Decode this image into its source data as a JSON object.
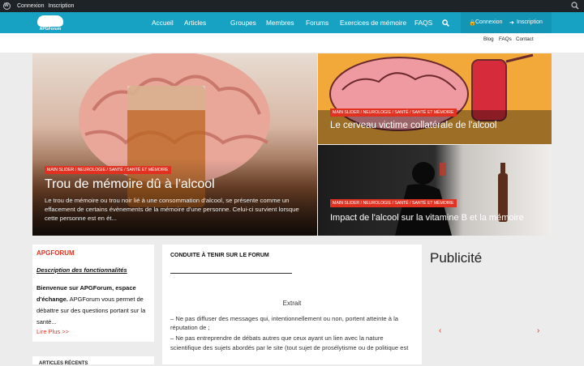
{
  "adminbar": {
    "connexion": "Connexion",
    "inscription": "Inscription"
  },
  "brand": {
    "logo_text": "APGForum"
  },
  "nav": {
    "items": [
      "Accueil",
      "Articles",
      "Groupes",
      "Membres",
      "Forums",
      "Exercices de mémoire",
      "FAQS"
    ],
    "connexion": "Connexion",
    "inscription": "Inscription"
  },
  "subnav": {
    "items": [
      "Blog",
      "FAQs",
      "Contact"
    ]
  },
  "slides": [
    {
      "tag": "Main Slider / Neurologie / Santé / Santé et mémoire",
      "title": "Trou de mémoire dû à l'alcool",
      "excerpt": "Le trou de mémoire ou trou noir lié à une consommation d'alcool, se présente comme un effacement de certains évènements de la mémoire d'une personne. Celui-ci survient lorsque cette personne est en ét..."
    },
    {
      "tag": "Main Slider / Neurologie / Santé / Santé et mémoire",
      "title": "Le cerveau victime collatérale de l'alcool"
    },
    {
      "tag": "Main Slider / Neurologie / Santé / Santé et mémoire",
      "title": "Impact de l'alcool sur la vitamine B et la mémoire"
    }
  ],
  "sidebar_left": {
    "heading": "APGFORUM",
    "link": "Description des fonctionnalités",
    "welcome": "Bienvenue sur APGForum, espace d'échange.",
    "body": "APGForum vous permet de débattre sur des questions portant sur la santé...",
    "more": "Lire Plus >>",
    "recent": "ARTICLES RÉCENTS"
  },
  "center": {
    "heading": "CONDUITE À TENIR SUR LE FORUM",
    "extrait": "Extrait",
    "rule1": "– Ne pas diffuser des messages qui, intentionnellement ou non, portent atteinte à la réputation de ;",
    "rule2": "– Ne pas entreprendre de débats autres que ceux ayant un lien avec la nature scientifique des sujets abordés par le site (tout sujet de prosélytisme ou de politique est"
  },
  "ad": {
    "heading": "Publicité",
    "prev": "‹",
    "next": "›"
  },
  "colors": {
    "nav": "#17a2c4",
    "accent": "#e03121",
    "adminbar": "#1d2327"
  }
}
